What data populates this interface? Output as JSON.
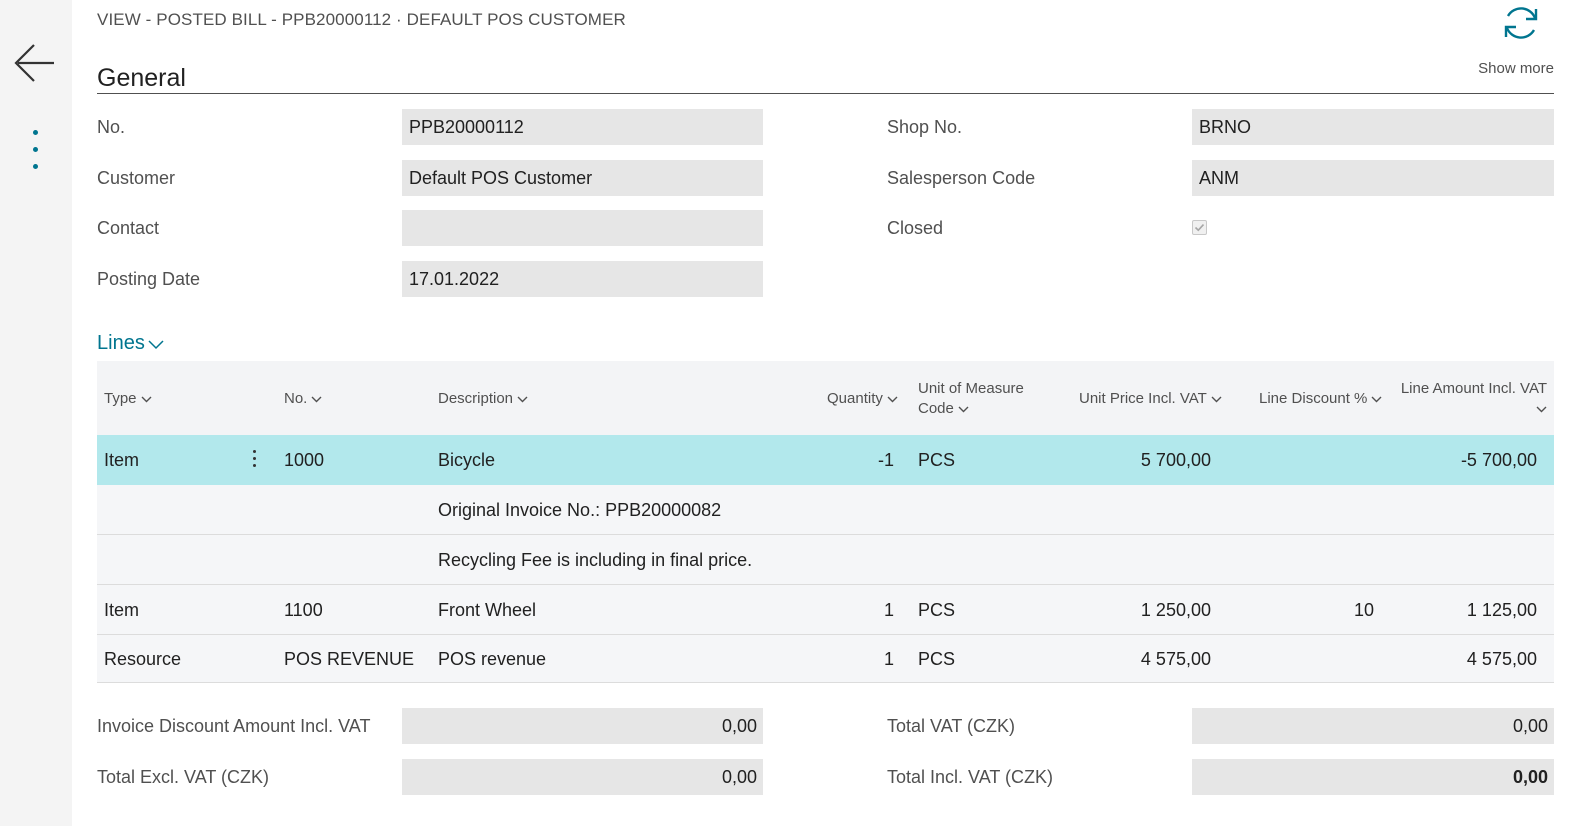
{
  "header": {
    "breadcrumb": "VIEW - POSTED BILL - PPB20000112 · DEFAULT POS CUSTOMER",
    "show_more": "Show more"
  },
  "general": {
    "title": "General",
    "no_label": "No.",
    "no_value": "PPB20000112",
    "customer_label": "Customer",
    "customer_value": "Default POS Customer",
    "contact_label": "Contact",
    "contact_value": "",
    "posting_date_label": "Posting Date",
    "posting_date_value": "17.01.2022",
    "shop_no_label": "Shop No.",
    "shop_no_value": "BRNO",
    "salesperson_label": "Salesperson Code",
    "salesperson_value": "ANM",
    "closed_label": "Closed",
    "closed_checked": true
  },
  "lines": {
    "title": "Lines",
    "columns": {
      "type": "Type",
      "no": "No.",
      "description": "Description",
      "quantity": "Quantity",
      "uom_1": "Unit of Measure",
      "uom_2": "Code",
      "unit_price": "Unit Price Incl. VAT",
      "line_discount": "Line Discount %",
      "line_amount": "Line Amount Incl. VAT"
    },
    "rows": [
      {
        "type": "Item",
        "no": "1000",
        "description": "Bicycle",
        "quantity": "-1",
        "uom": "PCS",
        "unit_price": "5 700,00",
        "line_discount": "",
        "line_amount": "-5 700,00"
      },
      {
        "type": "",
        "no": "",
        "description": "Original Invoice No.: PPB20000082",
        "quantity": "",
        "uom": "",
        "unit_price": "",
        "line_discount": "",
        "line_amount": ""
      },
      {
        "type": "",
        "no": "",
        "description": "Recycling Fee is including in final price.",
        "quantity": "",
        "uom": "",
        "unit_price": "",
        "line_discount": "",
        "line_amount": ""
      },
      {
        "type": "Item",
        "no": "1100",
        "description": "Front Wheel",
        "quantity": "1",
        "uom": "PCS",
        "unit_price": "1 250,00",
        "line_discount": "10",
        "line_amount": "1 125,00"
      },
      {
        "type": "Resource",
        "no": "POS REVENUE",
        "description": "POS revenue",
        "quantity": "1",
        "uom": "PCS",
        "unit_price": "4 575,00",
        "line_discount": "",
        "line_amount": "4 575,00"
      }
    ]
  },
  "totals": {
    "inv_disc_label": "Invoice Discount Amount Incl. VAT",
    "inv_disc_value": "0,00",
    "total_excl_label": "Total Excl. VAT (CZK)",
    "total_excl_value": "0,00",
    "total_vat_label": "Total VAT (CZK)",
    "total_vat_value": "0,00",
    "total_incl_label": "Total Incl. VAT (CZK)",
    "total_incl_value": "0,00"
  },
  "icons": {
    "back": "arrow-left-icon",
    "actions": "more-vertical-icon",
    "refresh": "refresh-icon",
    "closed_checkbox": "checkbox-checked-icon"
  },
  "colors": {
    "accent": "#00758f",
    "selected_row": "#b2e8ec",
    "field_bg": "#e6e6e6"
  }
}
